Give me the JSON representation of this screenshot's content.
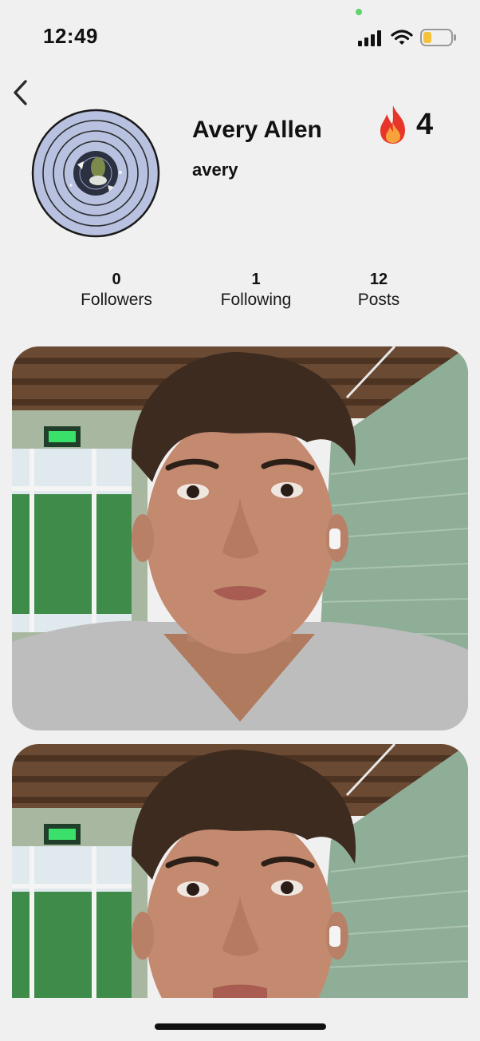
{
  "status_bar": {
    "time": "12:49",
    "signal_icon": "cellular-signal-icon",
    "wifi_icon": "wifi-icon",
    "battery_icon": "battery-low-icon",
    "battery_color": "#f5c23a"
  },
  "header": {
    "back_icon": "chevron-left-icon",
    "avatar_icon": "target-avatar",
    "display_name": "Avery Allen",
    "username": "avery",
    "streak": {
      "icon": "fire-icon",
      "count": "4"
    }
  },
  "stats": {
    "followers": {
      "value": "0",
      "label": "Followers"
    },
    "following": {
      "value": "1",
      "label": "Following"
    },
    "posts": {
      "value": "12",
      "label": "Posts"
    }
  },
  "posts": [
    {
      "kind": "selfie-photo"
    },
    {
      "kind": "selfie-photo"
    }
  ],
  "colors": {
    "background": "#f1f0f0",
    "text": "#111111",
    "privacy_indicator": "#5fd46b",
    "avatar_target": "#b8c2e0",
    "fire_outer": "#e8352a",
    "fire_inner": "#f7a23a"
  }
}
